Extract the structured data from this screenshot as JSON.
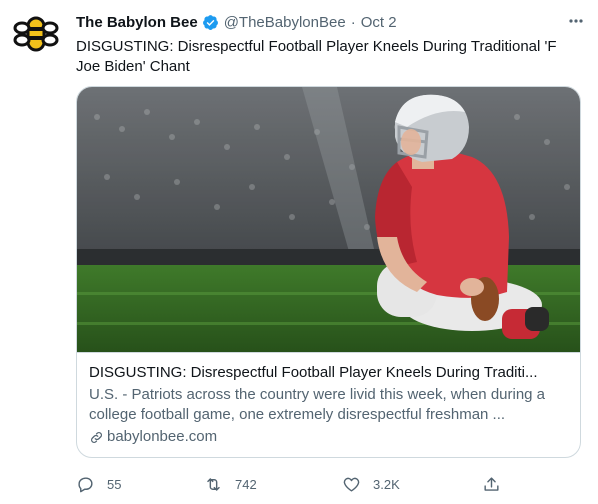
{
  "author": {
    "name": "The Babylon Bee",
    "handle": "@TheBabylonBee",
    "separator": "·",
    "date": "Oct 2"
  },
  "tweet": {
    "text": "DISGUSTING: Disrespectful Football Player Kneels During Traditional 'F Joe Biden' Chant"
  },
  "card": {
    "title": "DISGUSTING: Disrespectful Football Player Kneels During Traditi...",
    "description": "U.S. - Patriots across the country were livid this week, when during a college football game, one extremely disrespectful freshman ...",
    "domain": "babylonbee.com",
    "image_icon": "football-player-kneeling-photo"
  },
  "actions": {
    "reply_count": "55",
    "retweet_count": "742",
    "like_count": "3.2K",
    "share_icon": "share-icon"
  },
  "colors": {
    "verified": "#1d9bf0",
    "secondary_text": "#536471",
    "border": "#cfd9de",
    "logo_yellow": "#f3c21b"
  }
}
